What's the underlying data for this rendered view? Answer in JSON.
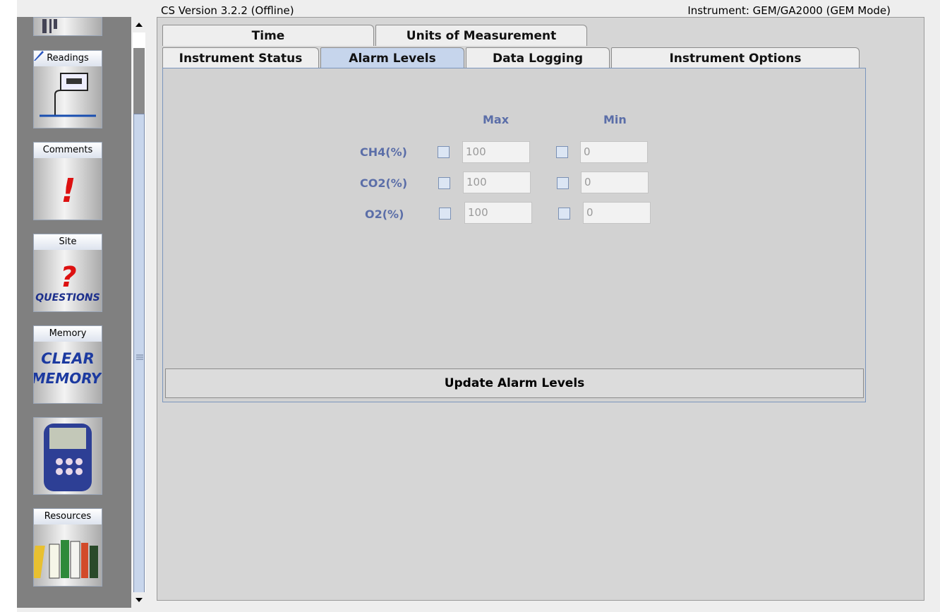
{
  "header": {
    "version": "CS Version 3.2.2 (Offline)",
    "instrument": "Instrument: GEM/GA2000 (GEM Mode)"
  },
  "sidebar": {
    "items": [
      {
        "label": "",
        "icon": "partial-tile-icon"
      },
      {
        "label": "Readings",
        "icon": "readings-icon"
      },
      {
        "label": "Comments",
        "icon": "comments-exclamation-icon"
      },
      {
        "label": "Site",
        "icon": "site-questions-icon",
        "art_text": "QUESTIONS"
      },
      {
        "label": "Memory",
        "icon": "clear-memory-icon",
        "art_text_1": "CLEAR",
        "art_text_2": "MEMORY"
      },
      {
        "label": "",
        "icon": "instrument-device-icon"
      },
      {
        "label": "Resources",
        "icon": "books-icon"
      }
    ]
  },
  "tabs": {
    "row1": [
      "Time",
      "Units of Measurement"
    ],
    "row2": [
      "Instrument Status",
      "Alarm Levels",
      "Data Logging",
      "Instrument Options"
    ],
    "active": "Alarm Levels"
  },
  "alarm": {
    "max_header": "Max",
    "min_header": "Min",
    "rows": [
      {
        "label": "CH4(%)",
        "max": "100",
        "min": "0"
      },
      {
        "label": "CO2(%)",
        "max": "100",
        "min": "0"
      },
      {
        "label": "O2(%)",
        "max": "100",
        "min": "0"
      }
    ],
    "update_button": "Update Alarm Levels"
  },
  "colors": {
    "accent_label": "#5b6ea8",
    "active_tab": "#c6d5ec",
    "panel": "#d2d2d2"
  }
}
